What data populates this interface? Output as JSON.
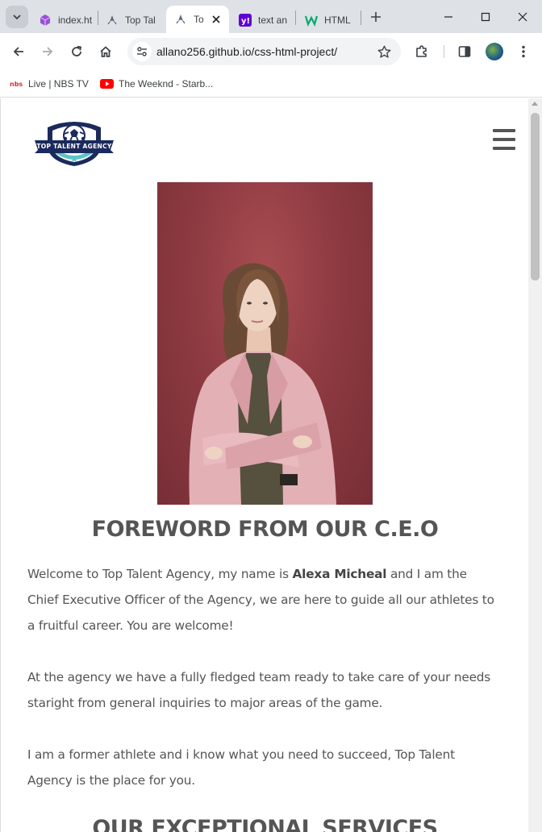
{
  "browser": {
    "tabs": [
      {
        "title": "index.html",
        "icon": "cube-icon"
      },
      {
        "title": "Top Talent Agency",
        "icon": "rocket-icon"
      },
      {
        "title": "Top Talent Agency",
        "icon": "rocket-icon",
        "active": true
      },
      {
        "title": "text and",
        "icon": "yahoo-icon"
      },
      {
        "title": "HTML",
        "icon": "w3-icon"
      }
    ],
    "url": "allano256.github.io/css-html-project/",
    "bookmarks": [
      {
        "label": "Live | NBS TV",
        "icon": "nbs-icon"
      },
      {
        "label": "The Weeknd - Starb...",
        "icon": "youtube-icon"
      }
    ]
  },
  "site": {
    "logo_text": "TOP TALENT AGENCY",
    "foreword": {
      "title": "FOREWORD FROM OUR C.E.O",
      "p1_before": "Welcome to Top Talent Agency, my name is ",
      "p1_name": "Alexa Micheal",
      "p1_after": " and I am the Chief Executive Officer of the Agency, we are here to guide all our athletes to a fruitful career. You are welcome!",
      "p2": "At the agency we have a fully fledged team ready to take care of your needs staright from general inquiries to major areas of the game.",
      "p3": "I am a former athlete and i know what you need to succeed, Top Talent Agency is the place for you."
    },
    "services_title": "OUR EXCEPTIONAL SERVICES"
  },
  "colors": {
    "tabstrip": "#dee1e6",
    "photo_bg": "#8f3b42",
    "heading": "#555555",
    "logo_navy": "#1b2a5c",
    "logo_teal": "#5ec4c8"
  }
}
